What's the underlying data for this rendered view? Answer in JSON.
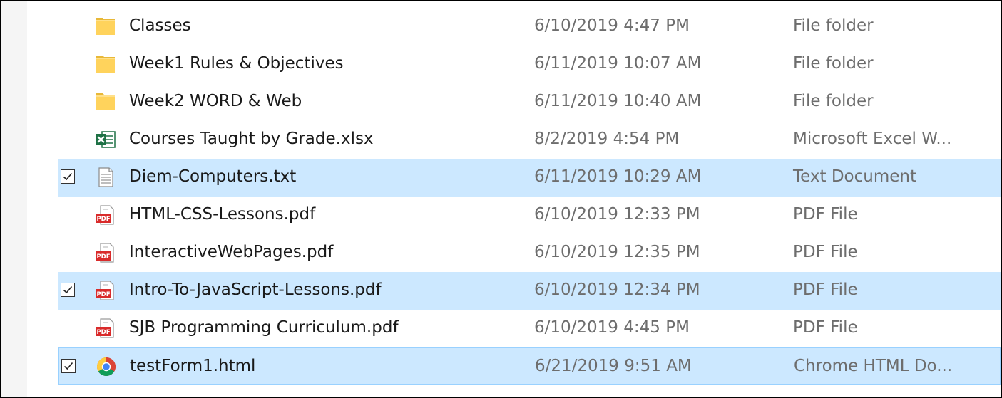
{
  "files": [
    {
      "name": "Classes",
      "date": "6/10/2019 4:47 PM",
      "type": "File folder",
      "icon": "folder-icon",
      "checked": false
    },
    {
      "name": "Week1 Rules & Objectives",
      "date": "6/11/2019 10:07 AM",
      "type": "File folder",
      "icon": "folder-icon",
      "checked": false
    },
    {
      "name": "Week2 WORD & Web",
      "date": "6/11/2019 10:40 AM",
      "type": "File folder",
      "icon": "folder-icon",
      "checked": false
    },
    {
      "name": "Courses Taught by Grade.xlsx",
      "date": "8/2/2019 4:54 PM",
      "type": "Microsoft Excel W...",
      "icon": "excel-icon",
      "checked": false
    },
    {
      "name": "Diem-Computers.txt",
      "date": "6/11/2019 10:29 AM",
      "type": "Text Document",
      "icon": "text-document-icon",
      "checked": true
    },
    {
      "name": "HTML-CSS-Lessons.pdf",
      "date": "6/10/2019 12:33 PM",
      "type": "PDF File",
      "icon": "pdf-icon",
      "checked": false
    },
    {
      "name": "InteractiveWebPages.pdf",
      "date": "6/10/2019 12:35 PM",
      "type": "PDF File",
      "icon": "pdf-icon",
      "checked": false
    },
    {
      "name": "Intro-To-JavaScript-Lessons.pdf",
      "date": "6/10/2019 12:34 PM",
      "type": "PDF File",
      "icon": "pdf-icon",
      "checked": true
    },
    {
      "name": "SJB Programming Curriculum.pdf",
      "date": "6/10/2019 4:45 PM",
      "type": "PDF File",
      "icon": "pdf-icon",
      "checked": false
    },
    {
      "name": "testForm1.html",
      "date": "6/21/2019 9:51 AM",
      "type": "Chrome HTML Do...",
      "icon": "chrome-icon",
      "checked": true,
      "focused": true
    }
  ],
  "colors": {
    "selection": "#cce8ff",
    "focus_border": "#99d1ff",
    "secondary_text": "#6d6d6d",
    "folder": "#ffd35c",
    "pdf": "#d92b2b",
    "excel": "#1e7145"
  }
}
